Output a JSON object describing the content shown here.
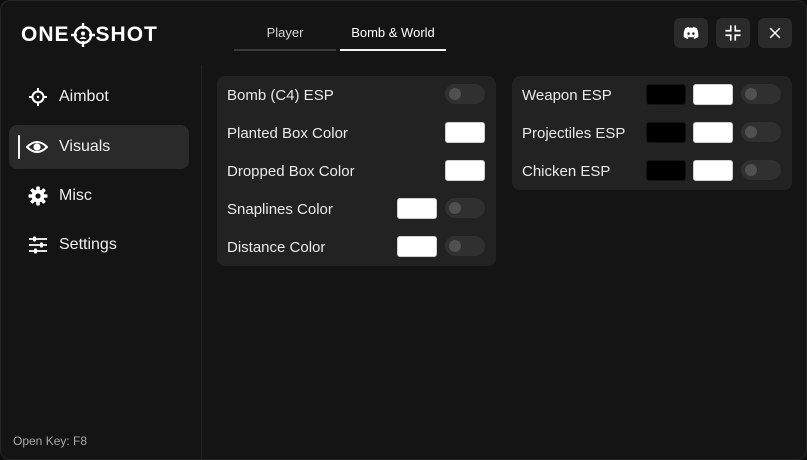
{
  "app": {
    "logo_left": "ONE",
    "logo_right": "SHOT"
  },
  "tabs": [
    {
      "label": "Player",
      "active": false
    },
    {
      "label": "Bomb & World",
      "active": true
    }
  ],
  "header_buttons": [
    {
      "icon": "discord-icon"
    },
    {
      "icon": "minimize-icon"
    },
    {
      "icon": "close-icon"
    }
  ],
  "sidebar": {
    "items": [
      {
        "label": "Aimbot",
        "icon": "crosshair-icon",
        "active": false
      },
      {
        "label": "Visuals",
        "icon": "eye-icon",
        "active": true
      },
      {
        "label": "Misc",
        "icon": "gear-icon",
        "active": false
      },
      {
        "label": "Settings",
        "icon": "sliders-icon",
        "active": false
      }
    ],
    "open_key": "Open Key: F8"
  },
  "bomb_panel": {
    "rows": [
      {
        "label": "Bomb (C4) ESP",
        "color": null,
        "toggle": false
      },
      {
        "label": "Planted Box Color",
        "color": "#ffffff",
        "toggle": null
      },
      {
        "label": "Dropped Box Color",
        "color": "#ffffff",
        "toggle": null
      },
      {
        "label": "Snaplines Color",
        "color": "#ffffff",
        "toggle": false
      },
      {
        "label": "Distance Color",
        "color": "#ffffff",
        "toggle": false
      }
    ]
  },
  "world_panel": {
    "rows": [
      {
        "label": "Weapon ESP",
        "colors": [
          "#000000",
          "#ffffff"
        ],
        "toggle": false
      },
      {
        "label": "Projectiles ESP",
        "colors": [
          "#000000",
          "#ffffff"
        ],
        "toggle": false
      },
      {
        "label": "Chicken ESP",
        "colors": [
          "#000000",
          "#ffffff"
        ],
        "toggle": false
      }
    ]
  }
}
